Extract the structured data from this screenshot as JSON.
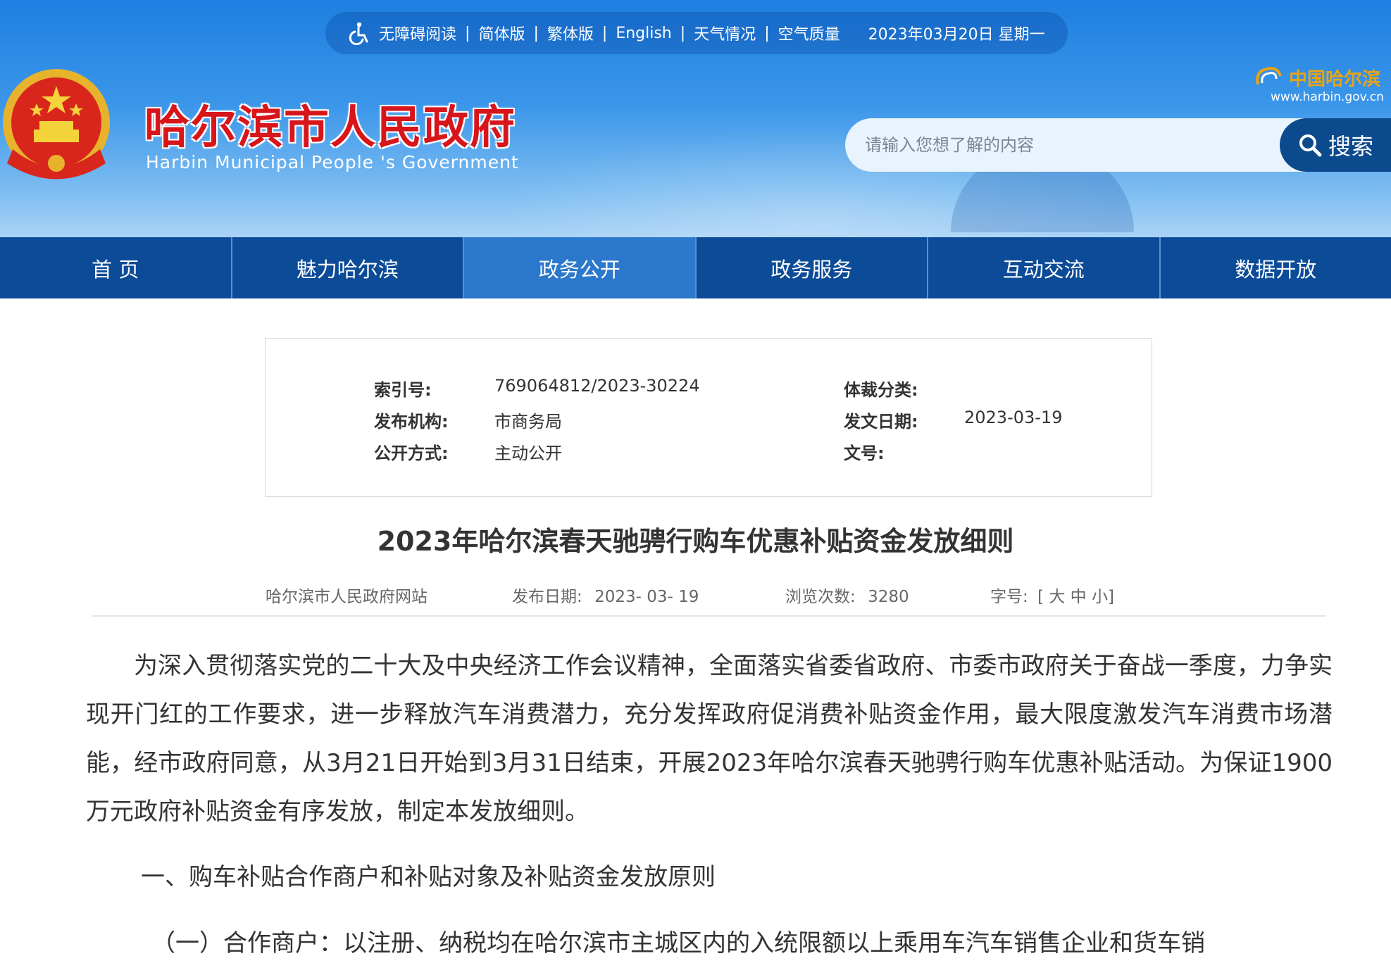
{
  "topbar": {
    "accessibility": "无障碍阅读",
    "simplified": "简体版",
    "traditional": "繁体版",
    "english": "English",
    "weather": "天气情况",
    "air_quality": "空气质量",
    "separator": "|",
    "date": "2023年03月20日 星期一"
  },
  "header": {
    "title": "哈尔滨市人民政府",
    "subtitle": "Harbin Municipal People 's Government",
    "logo_cn": "中国哈尔滨",
    "logo_url": "www.harbin.gov.cn"
  },
  "search": {
    "placeholder": "请输入您想了解的内容",
    "button_label": "搜索"
  },
  "nav": {
    "items": [
      {
        "label": "首 页"
      },
      {
        "label": "魅力哈尔滨"
      },
      {
        "label": "政务公开"
      },
      {
        "label": "政务服务"
      },
      {
        "label": "互动交流"
      },
      {
        "label": "数据开放"
      }
    ],
    "active_index": 2
  },
  "meta": {
    "index_label": "索引号:",
    "index_value": "769064812/2023-30224",
    "category_label": "体裁分类:",
    "category_value": "",
    "publisher_label": "发布机构:",
    "publisher_value": "市商务局",
    "issue_date_label": "发文日期:",
    "issue_date_value": "2023-03-19",
    "disclosure_label": "公开方式:",
    "disclosure_value": "主动公开",
    "doc_no_label": "文号:",
    "doc_no_value": ""
  },
  "article": {
    "title": "2023年哈尔滨春天驰骋行购车优惠补贴资金发放细则",
    "source": "哈尔滨市人民政府网站",
    "publish_label": "发布日期:",
    "publish_date": "2023- 03- 19",
    "views_label": "浏览次数:",
    "views": "3280",
    "font_label": "字号:",
    "font_open": "[",
    "font_large": "大",
    "font_medium": "中",
    "font_small": "小",
    "font_close": "]",
    "paragraph1": "为深入贯彻落实党的二十大及中央经济工作会议精神，全面落实省委省政府、市委市政府关于奋战一季度，力争实现开门红的工作要求，进一步释放汽车消费潜力，充分发挥政府促消费补贴资金作用，最大限度激发汽车消费市场潜能，经市政府同意，从3月21日开始到3月31日结束，开展2023年哈尔滨春天驰骋行购车优惠补贴活动。为保证1900万元政府补贴资金有序发放，制定本发放细则。",
    "heading1": "一、购车补贴合作商户和补贴对象及补贴资金发放原则",
    "paragraph2": "（一）合作商户：以注册、纳税均在哈尔滨市主城区内的入统限额以上乘用车汽车销售企业和货车销"
  },
  "colors": {
    "nav_bg": "#0c4b97",
    "nav_active": "#2b78cc",
    "title_red": "#d7151a",
    "search_btn": "#0c4a8e"
  }
}
